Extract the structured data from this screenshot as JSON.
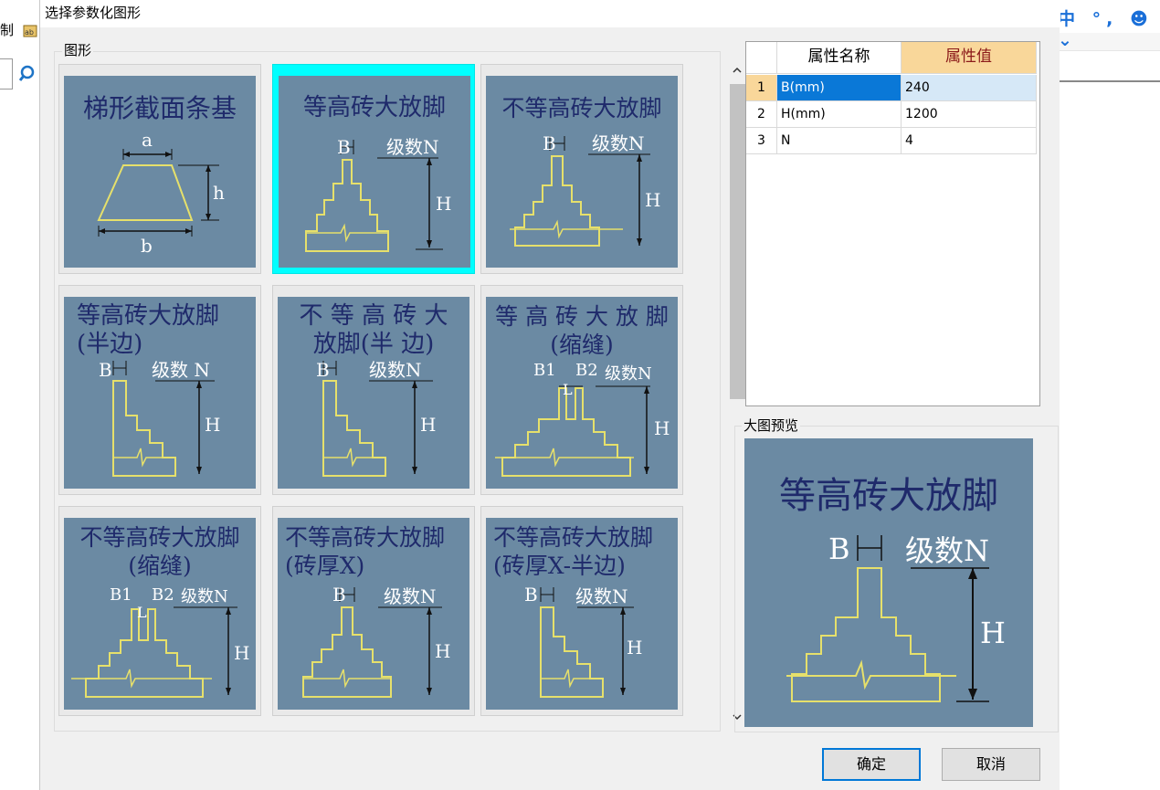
{
  "background": {
    "menu_fragment": "制",
    "ime": {
      "text": "中 °, ☻ ⌄"
    }
  },
  "dialog": {
    "title": "选择参数化图形",
    "shapes_group_label": "图形",
    "preview_group_label": "大图预览",
    "ok_label": "确定",
    "cancel_label": "取消"
  },
  "tiles": [
    {
      "title": "梯形截面条基",
      "kind": "trapezoid",
      "labels": [
        "a",
        "h",
        "b"
      ]
    },
    {
      "title": "等高砖大放脚",
      "kind": "step-equal",
      "labels": [
        "B",
        "级数N",
        "H"
      ],
      "selected": true
    },
    {
      "title": "不等高砖大放脚",
      "kind": "step-unequal",
      "labels": [
        "B",
        "级数N",
        "H"
      ]
    },
    {
      "title": "等高砖大放脚\n(半边)",
      "kind": "step-half",
      "labels": [
        "B",
        "级数 N",
        "H"
      ]
    },
    {
      "title": "不 等 高 砖 大\n放脚(半 边)",
      "kind": "step-half",
      "labels": [
        "B",
        "级数N",
        "H"
      ]
    },
    {
      "title": "等 高 砖 大 放 脚\n(缩缝)",
      "kind": "step-joint",
      "labels": [
        "B1",
        "B2",
        "L",
        "级数N",
        "H"
      ]
    },
    {
      "title": "不等高砖大放脚\n(缩缝)",
      "kind": "step-joint",
      "labels": [
        "B1",
        "B2",
        "L",
        "级数N",
        "H"
      ]
    },
    {
      "title": "不等高砖大放脚\n(砖厚X)",
      "kind": "step-equal",
      "labels": [
        "B",
        "级数N",
        "H"
      ]
    },
    {
      "title": "不等高砖大放脚\n(砖厚X-半边)",
      "kind": "step-half",
      "labels": [
        "B",
        "级数N",
        "H"
      ]
    }
  ],
  "properties": {
    "headers": [
      "属性名称",
      "属性值"
    ],
    "rows": [
      {
        "index": "1",
        "name": "B(mm)",
        "value": "240"
      },
      {
        "index": "2",
        "name": "H(mm)",
        "value": "1200"
      },
      {
        "index": "3",
        "name": "N",
        "value": "4"
      }
    ]
  },
  "preview": {
    "title": "等高砖大放脚",
    "labels": [
      "B",
      "级数N",
      "H"
    ]
  },
  "colors": {
    "tile_bg": "#6b8aa3",
    "tile_title": "#1f2a6b",
    "line_yellow": "#e6e06b",
    "selection": "#00ffff",
    "header_value_bg": "#f9d79a",
    "row_selected": "#0a78d7"
  },
  "icons": {
    "search": "magnifier-icon",
    "scroll_up": "chevron-up-icon",
    "scroll_down": "chevron-down-icon"
  }
}
